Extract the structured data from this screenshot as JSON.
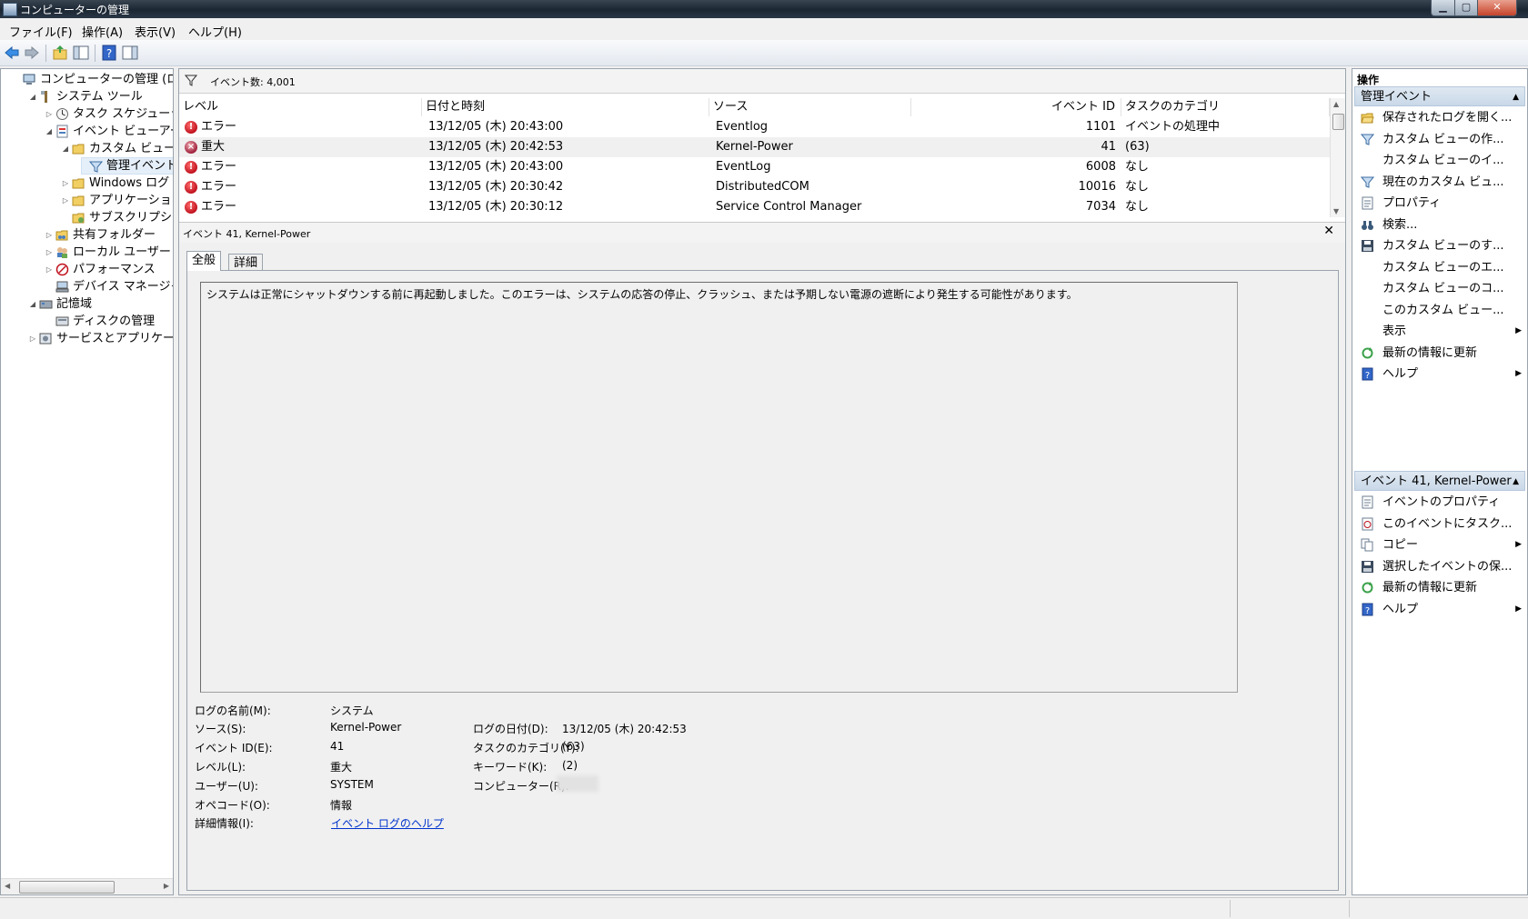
{
  "window": {
    "title": "コンピューターの管理"
  },
  "menu": [
    "ファイル(F)",
    "操作(A)",
    "表示(V)",
    "ヘルプ(H)"
  ],
  "tree": [
    {
      "label": "コンピューターの管理 (ローカ",
      "depth": 0,
      "expand": "",
      "icon": "computer-management-icon"
    },
    {
      "label": "システム ツール",
      "depth": 1,
      "expand": "◢",
      "icon": "tools-icon"
    },
    {
      "label": "タスク スケジューラ",
      "depth": 2,
      "expand": "▷",
      "icon": "clock-icon"
    },
    {
      "label": "イベント ビューアー",
      "depth": 2,
      "expand": "◢",
      "icon": "event-viewer-icon"
    },
    {
      "label": "カスタム ビュー",
      "depth": 3,
      "expand": "◢",
      "icon": "folder-icon"
    },
    {
      "label": "管理イベント",
      "depth": 4,
      "expand": "",
      "icon": "filter-icon",
      "selected": true
    },
    {
      "label": "Windows ログ",
      "depth": 3,
      "expand": "▷",
      "icon": "folder-icon"
    },
    {
      "label": "アプリケーションと",
      "depth": 3,
      "expand": "▷",
      "icon": "folder-icon"
    },
    {
      "label": "サブスクリプション",
      "depth": 3,
      "expand": "",
      "icon": "subscription-icon"
    },
    {
      "label": "共有フォルダー",
      "depth": 2,
      "expand": "▷",
      "icon": "shared-folder-icon"
    },
    {
      "label": "ローカル ユーザーとグ",
      "depth": 2,
      "expand": "▷",
      "icon": "users-icon"
    },
    {
      "label": "パフォーマンス",
      "depth": 2,
      "expand": "▷",
      "icon": "performance-icon"
    },
    {
      "label": "デバイス マネージャー",
      "depth": 2,
      "expand": "",
      "icon": "device-manager-icon"
    },
    {
      "label": "記憶域",
      "depth": 1,
      "expand": "◢",
      "icon": "storage-icon"
    },
    {
      "label": "ディスクの管理",
      "depth": 2,
      "expand": "",
      "icon": "disk-icon"
    },
    {
      "label": "サービスとアプリケーショ",
      "depth": 1,
      "expand": "▷",
      "icon": "services-icon"
    }
  ],
  "filter": {
    "text": "イベント数: 4,001"
  },
  "columns": [
    "レベル",
    "日付と時刻",
    "ソース",
    "イベント ID",
    "タスクのカテゴリ"
  ],
  "events": [
    {
      "level": "エラー",
      "type": "error",
      "datetime": "13/12/05 (木) 20:43:00",
      "source": "Eventlog",
      "id": "1101",
      "category": "イベントの処理中"
    },
    {
      "level": "重大",
      "type": "critical",
      "datetime": "13/12/05 (木) 20:42:53",
      "source": "Kernel-Power",
      "id": "41",
      "category": "(63)",
      "selected": true
    },
    {
      "level": "エラー",
      "type": "error",
      "datetime": "13/12/05 (木) 20:43:00",
      "source": "EventLog",
      "id": "6008",
      "category": "なし"
    },
    {
      "level": "エラー",
      "type": "error",
      "datetime": "13/12/05 (木) 20:30:42",
      "source": "DistributedCOM",
      "id": "10016",
      "category": "なし"
    },
    {
      "level": "エラー",
      "type": "error",
      "datetime": "13/12/05 (木) 20:30:12",
      "source": "Service Control Manager",
      "id": "7034",
      "category": "なし"
    }
  ],
  "detail": {
    "title": "イベント 41, Kernel-Power",
    "tabs": [
      "全般",
      "詳細"
    ],
    "description": "システムは正常にシャットダウンする前に再起動しました。このエラーは、システムの応答の停止、クラッシュ、または予期しない電源の遮断により発生する可能性があります。",
    "fields": {
      "log_name_label": "ログの名前(M):",
      "log_name": "システム",
      "source_label": "ソース(S):",
      "source": "Kernel-Power",
      "logged_label": "ログの日付(D):",
      "logged": "13/12/05 (木) 20:42:53",
      "event_id_label": "イベント ID(E):",
      "event_id": "41",
      "task_label": "タスクのカテゴリ(Y):",
      "task": "(63)",
      "level_label": "レベル(L):",
      "level": "重大",
      "keywords_label": "キーワード(K):",
      "keywords": "(2)",
      "user_label": "ユーザー(U):",
      "user": "SYSTEM",
      "computer_label": "コンピューター(R):",
      "computer": "",
      "opcode_label": "オペコード(O):",
      "opcode": "情報",
      "more_label": "詳細情報(I):",
      "more_link": "イベント ログのヘルプ"
    }
  },
  "actions": {
    "header": "操作",
    "section1": "管理イベント",
    "items1": [
      {
        "label": "保存されたログを開く...",
        "icon": "open-folder-icon",
        "submenu": false
      },
      {
        "label": "カスタム ビューの作...",
        "icon": "filter-icon",
        "submenu": false
      },
      {
        "label": "カスタム ビューのイ...",
        "icon": "",
        "submenu": false
      },
      {
        "label": "現在のカスタム ビュ...",
        "icon": "filter-icon",
        "submenu": false
      },
      {
        "label": "プロパティ",
        "icon": "properties-icon",
        "submenu": false
      },
      {
        "label": "検索...",
        "icon": "binoculars-icon",
        "submenu": false
      },
      {
        "label": "カスタム ビューのす...",
        "icon": "save-icon",
        "submenu": false
      },
      {
        "label": "カスタム ビューのエ...",
        "icon": "",
        "submenu": false
      },
      {
        "label": "カスタム ビューのコ...",
        "icon": "",
        "submenu": false
      },
      {
        "label": "このカスタム ビュー...",
        "icon": "",
        "submenu": false
      },
      {
        "label": "表示",
        "icon": "",
        "submenu": true
      },
      {
        "label": "最新の情報に更新",
        "icon": "refresh-icon",
        "submenu": false
      },
      {
        "label": "ヘルプ",
        "icon": "help-icon",
        "submenu": true
      }
    ],
    "section2": "イベント 41, Kernel-Power",
    "items2": [
      {
        "label": "イベントのプロパティ",
        "icon": "properties-icon",
        "submenu": false
      },
      {
        "label": "このイベントにタスク...",
        "icon": "task-icon",
        "submenu": false
      },
      {
        "label": "コピー",
        "icon": "copy-icon",
        "submenu": true
      },
      {
        "label": "選択したイベントの保...",
        "icon": "save-icon",
        "submenu": false
      },
      {
        "label": "最新の情報に更新",
        "icon": "refresh-icon",
        "submenu": false
      },
      {
        "label": "ヘルプ",
        "icon": "help-icon",
        "submenu": true
      }
    ]
  },
  "colors": {
    "accent": "#c9d8e8",
    "error": "#c0121e",
    "critical": "#a0203b",
    "link": "#0033cc"
  }
}
